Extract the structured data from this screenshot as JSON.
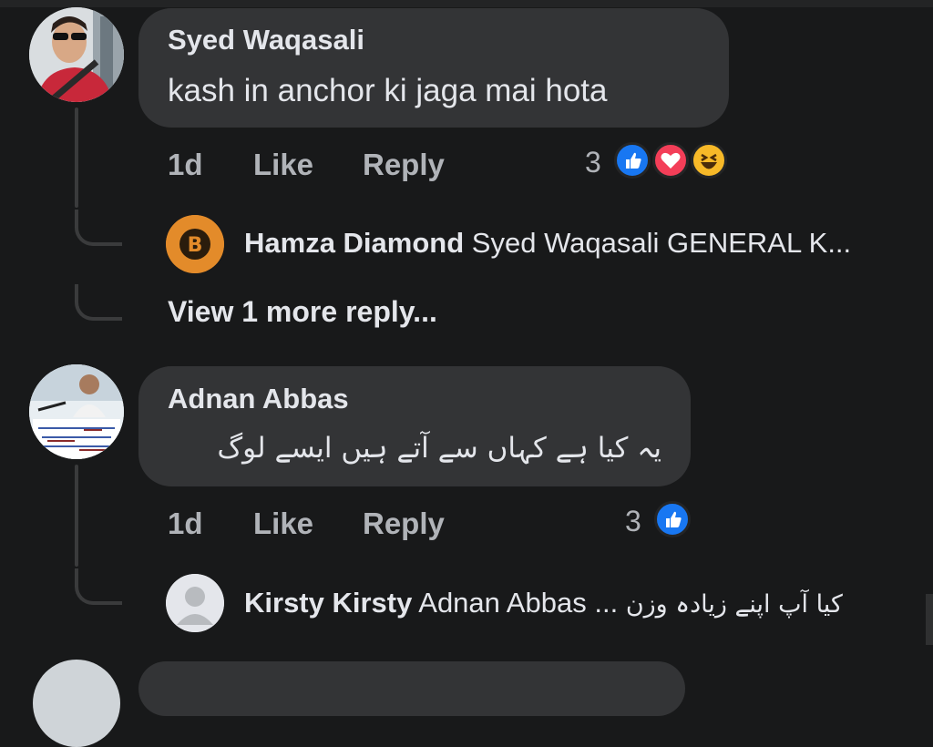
{
  "comments": [
    {
      "author": "Syed Waqasali",
      "text": "kash in anchor ki jaga mai hota",
      "time": "1d",
      "like_label": "Like",
      "reply_label": "Reply",
      "reaction_count": "3",
      "reactions": [
        "like-icon",
        "love-icon",
        "haha-icon"
      ],
      "reply": {
        "author": "Hamza Diamond",
        "text": "Syed Waqasali GENERAL  K..."
      },
      "view_more": "View 1 more reply..."
    },
    {
      "author": "Adnan Abbas",
      "text": "یہ کیا ہے کہاں سے آتے ہیں ایسے لوگ",
      "time": "1d",
      "like_label": "Like",
      "reply_label": "Reply",
      "reaction_count": "3",
      "reactions": [
        "like-icon"
      ],
      "reply": {
        "author": "Kirsty Kirsty",
        "text_prefix": "Adnan Abbas",
        "text_ellipsis": "...",
        "text_urdu": "کیا آپ اپنے زیادہ وزن"
      }
    }
  ],
  "colors": {
    "background": "#18191a",
    "bubble": "#333436",
    "secondary_text": "#b0b3b8",
    "like_blue": "#1877f2",
    "love_red": "#f33e58",
    "haha_yellow": "#f7b928"
  }
}
